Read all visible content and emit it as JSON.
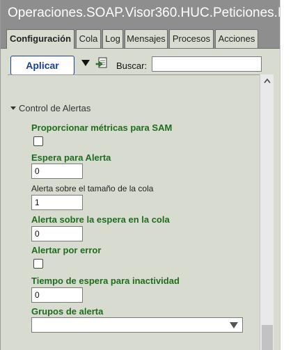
{
  "window": {
    "title": "Operaciones.SOAP.Visor360.HUC.Peticiones.L"
  },
  "tabs": [
    {
      "label": "Configuración",
      "active": true
    },
    {
      "label": "Cola"
    },
    {
      "label": "Log"
    },
    {
      "label": "Mensajes"
    },
    {
      "label": "Procesos"
    },
    {
      "label": "Acciones"
    }
  ],
  "toolbar": {
    "apply_label": "Aplicar",
    "search_label": "Buscar:",
    "search_value": ""
  },
  "section": {
    "title": "Control de Alertas",
    "expanded": true
  },
  "fields": {
    "sam_metrics": {
      "label": "Proporcionar métricas para SAM",
      "checked": false
    },
    "alert_wait": {
      "label": "Espera para Alerta",
      "value": "0"
    },
    "queue_size_alert": {
      "label": "Alerta sobre el tamaño de la cola",
      "value": "1"
    },
    "queue_wait_alert": {
      "label": "Alerta sobre la espera en la cola",
      "value": "0"
    },
    "alert_on_error": {
      "label": "Alertar por error",
      "checked": false
    },
    "inactivity_timeout": {
      "label": "Tiempo de espera para inactividad",
      "value": "0"
    },
    "alert_groups": {
      "label": "Grupos de alerta",
      "value": ""
    }
  },
  "colors": {
    "accent_blue": "#1b3f8f",
    "label_green": "#1f6b1f",
    "panel_bg": "#d8dcd0",
    "header_gray": "#8e8e8e"
  }
}
